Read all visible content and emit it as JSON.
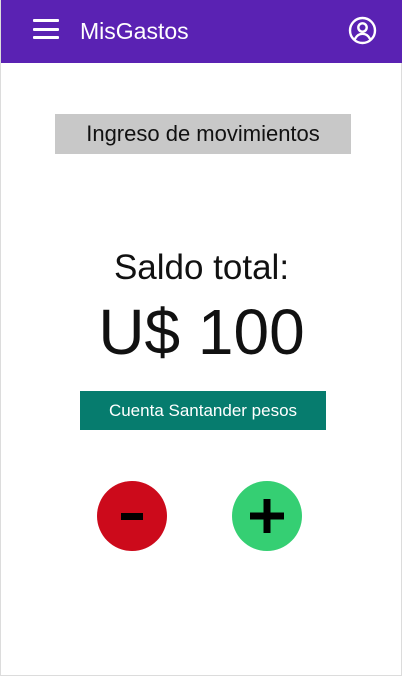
{
  "appbar": {
    "title": "MisGastos",
    "menu_icon": "hamburger-menu-icon",
    "account_icon": "account-circle-icon",
    "background": "#5a22b3"
  },
  "main": {
    "section_heading": "Ingreso de movimientos",
    "balance_label": "Saldo total:",
    "balance_amount": "U$ 100",
    "account_selector": "Cuenta Santander pesos"
  },
  "actions": {
    "minus_icon": "minus-icon",
    "plus_icon": "plus-icon",
    "minus_color": "#cc0a1b",
    "plus_color": "#35cf73",
    "account_chip_color": "#067c6e"
  }
}
